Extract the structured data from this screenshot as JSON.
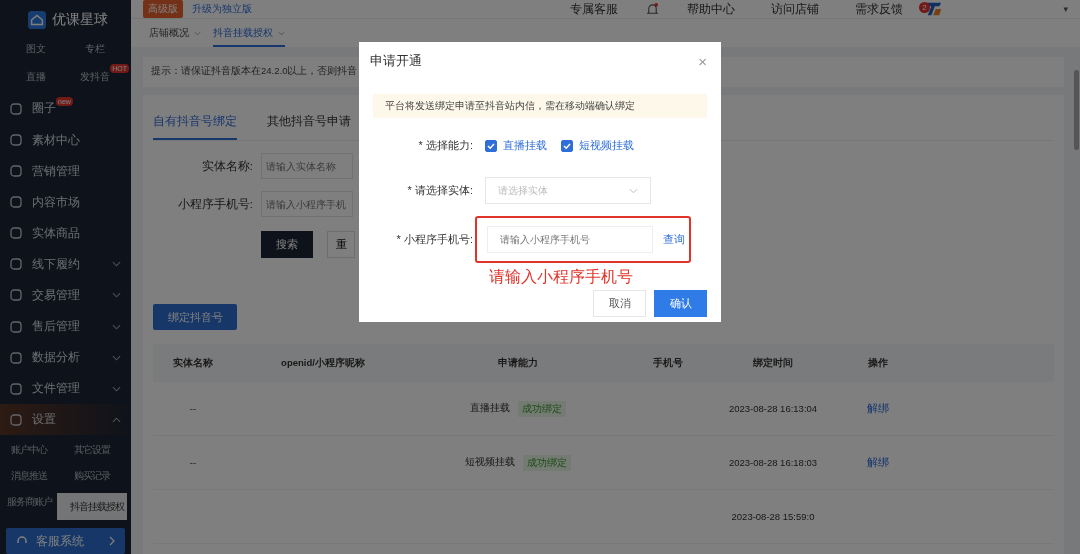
{
  "sidebar": {
    "logo": "优课星球",
    "shortcuts": [
      {
        "label": "图文"
      },
      {
        "label": "专栏"
      },
      {
        "label": "直播"
      },
      {
        "label": "发抖音",
        "badge": "HOT"
      }
    ],
    "items": [
      {
        "label": "圈子",
        "badge": "new",
        "has_children": false,
        "expanded": false
      },
      {
        "label": "素材中心",
        "has_children": false,
        "expanded": false
      },
      {
        "label": "营销管理",
        "has_children": false,
        "expanded": false
      },
      {
        "label": "内容市场",
        "has_children": false,
        "expanded": false
      },
      {
        "label": "实体商品",
        "has_children": false,
        "expanded": false
      },
      {
        "label": "线下履约",
        "has_children": true,
        "expanded": false
      },
      {
        "label": "交易管理",
        "has_children": true,
        "expanded": false
      },
      {
        "label": "售后管理",
        "has_children": true,
        "expanded": false
      },
      {
        "label": "数据分析",
        "has_children": true,
        "expanded": false
      },
      {
        "label": "文件管理",
        "has_children": true,
        "expanded": false
      },
      {
        "label": "设置",
        "has_children": true,
        "expanded": true,
        "children": [
          {
            "label": "账户中心",
            "selected": false
          },
          {
            "label": "其它设置",
            "selected": false
          },
          {
            "label": "消息推送",
            "selected": false
          },
          {
            "label": "购买记录",
            "selected": false
          },
          {
            "label": "服务商账户",
            "selected": false
          },
          {
            "label": "抖音挂载授权",
            "selected": true
          }
        ]
      }
    ],
    "service_button": "客服系统"
  },
  "header": {
    "edition_badge": "高级版",
    "upgrade_link": "升级为独立版",
    "links": [
      "专属客服",
      "帮助中心",
      "访问店铺",
      "需求反馈"
    ],
    "feedback_count": "2",
    "caret": "▾"
  },
  "breadcrumb_tabs": [
    {
      "label": "店铺概况",
      "selected": false
    },
    {
      "label": "抖音挂载授权",
      "selected": true
    }
  ],
  "hint": "提示：请保证抖音版本在24.2.0以上，否则抖音",
  "tabs": [
    {
      "label": "自有抖音号绑定",
      "selected": true
    },
    {
      "label": "其他抖音号申请",
      "selected": false
    }
  ],
  "filters": [
    {
      "label": "实体名称:",
      "placeholder": "请输入实体名称"
    },
    {
      "label": "小程序手机号:",
      "placeholder": "请输入小程序手机"
    }
  ],
  "search_button": "搜索",
  "reset_button": "重",
  "bind_button": "绑定抖音号",
  "table": {
    "columns": [
      "实体名称",
      "openid/小程序昵称",
      "申请能力",
      "手机号",
      "绑定时间",
      "操作"
    ],
    "rows": [
      {
        "entity": "--",
        "capability": "直播挂载",
        "status": "成功绑定",
        "time": "2023-08-28 16:13:04",
        "action": "解绑"
      },
      {
        "entity": "--",
        "capability": "短视频挂载",
        "status": "成功绑定",
        "time": "2023-08-28 16:18:03",
        "action": "解绑"
      },
      {
        "time": "2023-08-28 15:59:0"
      }
    ]
  },
  "dialog": {
    "title": "申请开通",
    "close": "×",
    "notice": "平台将发送绑定申请至抖音站内信，需在移动端确认绑定",
    "ability_label": "* 选择能力:",
    "abilities": [
      {
        "label": "直播挂载",
        "checked": true
      },
      {
        "label": "短视频挂载",
        "checked": true
      }
    ],
    "entity_label": "* 请选择实体:",
    "entity_placeholder": "请选择实体",
    "phone_label": "* 小程序手机号:",
    "phone_placeholder": "请输入小程序手机号",
    "query_link": "查询",
    "annotation": "请输入小程序手机号",
    "cancel": "取消",
    "confirm": "确认"
  }
}
